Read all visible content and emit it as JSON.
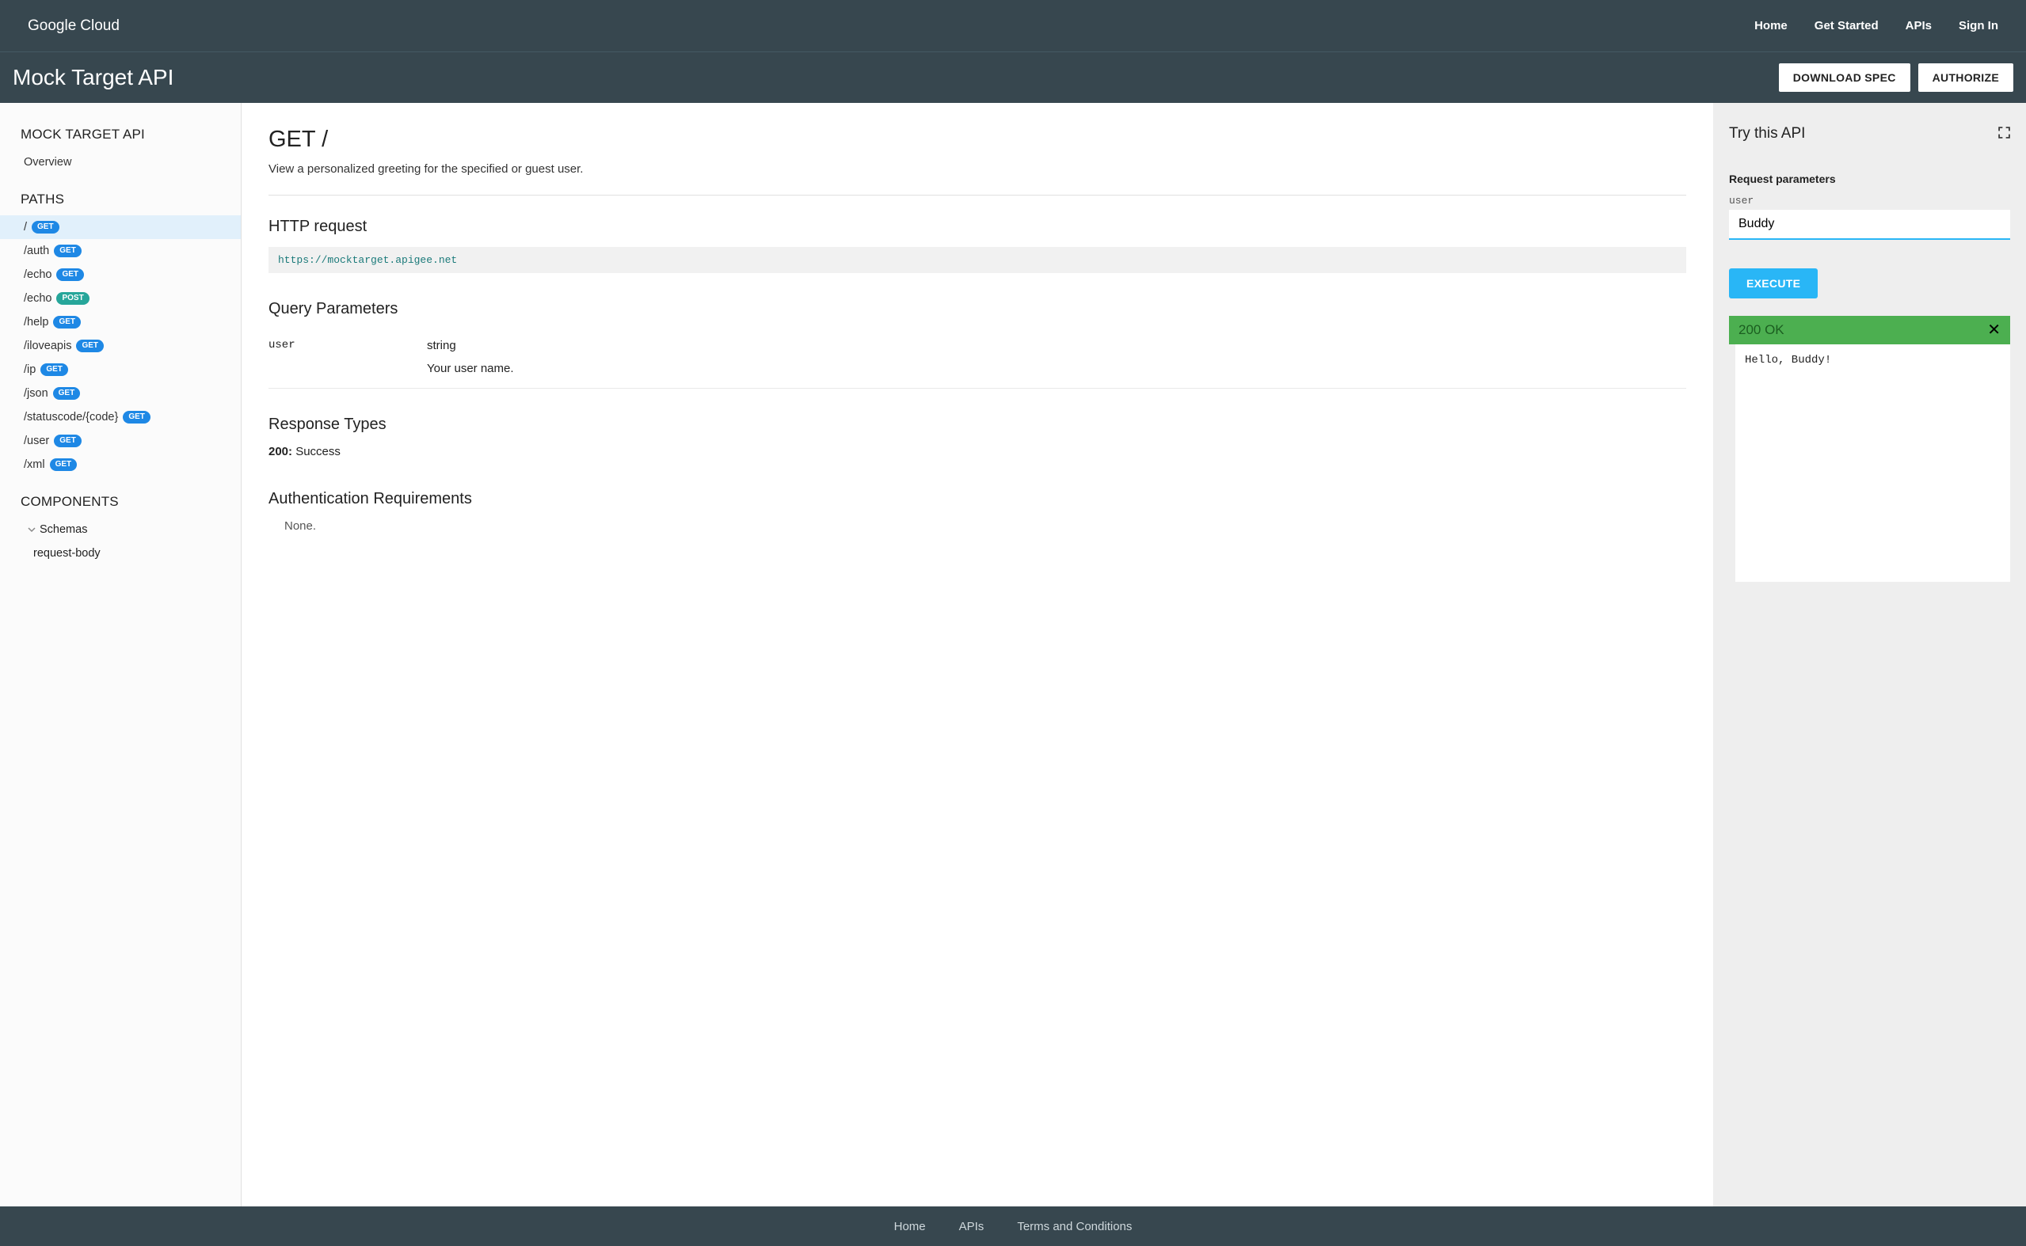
{
  "topnav": {
    "logo_prefix": "Google",
    "logo_suffix": "Cloud",
    "links": [
      "Home",
      "Get Started",
      "APIs",
      "Sign In"
    ]
  },
  "subheader": {
    "title": "Mock Target API",
    "download_label": "DOWNLOAD SPEC",
    "authorize_label": "AUTHORIZE"
  },
  "sidebar": {
    "api_title": "MOCK TARGET API",
    "overview_label": "Overview",
    "paths_title": "PATHS",
    "paths": [
      {
        "path": "/",
        "method": "GET",
        "selected": true
      },
      {
        "path": "/auth",
        "method": "GET"
      },
      {
        "path": "/echo",
        "method": "GET"
      },
      {
        "path": "/echo",
        "method": "POST"
      },
      {
        "path": "/help",
        "method": "GET"
      },
      {
        "path": "/iloveapis",
        "method": "GET"
      },
      {
        "path": "/ip",
        "method": "GET"
      },
      {
        "path": "/json",
        "method": "GET"
      },
      {
        "path": "/statuscode/{code}",
        "method": "GET"
      },
      {
        "path": "/user",
        "method": "GET"
      },
      {
        "path": "/xml",
        "method": "GET"
      }
    ],
    "components_title": "COMPONENTS",
    "schemas_label": "Schemas",
    "schema_items": [
      "request-body"
    ]
  },
  "doc": {
    "title": "GET /",
    "description": "View a personalized greeting for the specified or guest user.",
    "http_request_title": "HTTP request",
    "http_url": "https://mocktarget.apigee.net",
    "query_params_title": "Query Parameters",
    "param_name": "user",
    "param_type": "string",
    "param_desc": "Your user name.",
    "response_types_title": "Response Types",
    "response_code": "200:",
    "response_text": " Success",
    "auth_title": "Authentication Requirements",
    "auth_value": "None."
  },
  "try": {
    "title": "Try this API",
    "request_params_title": "Request parameters",
    "param_label": "user",
    "param_value": "Buddy",
    "execute_label": "EXECUTE",
    "status_text": "200 OK",
    "response_body": "Hello, Buddy!"
  },
  "footer": {
    "links": [
      "Home",
      "APIs",
      "Terms and Conditions"
    ]
  }
}
